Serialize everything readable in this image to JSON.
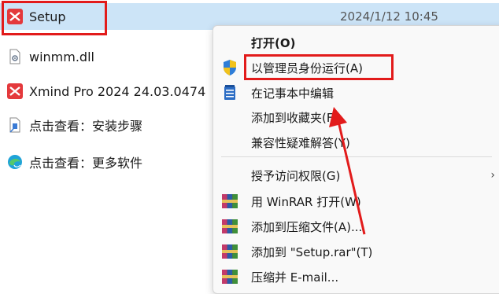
{
  "files": [
    {
      "name": "Setup",
      "date": "2024/1/12 10:45",
      "icon": "xmind-icon",
      "selected": true
    },
    {
      "name": "winmm.dll",
      "icon": "dll-file-icon"
    },
    {
      "name": "Xmind Pro 2024 24.03.0474",
      "icon": "xmind-icon"
    },
    {
      "name": "点击查看：安装步骤",
      "icon": "shortcut-document-icon"
    },
    {
      "name": "点击查看：更多软件",
      "icon": "edge-browser-icon"
    }
  ],
  "context_menu": {
    "items": [
      {
        "label": "打开(O)",
        "icon": "",
        "bold": true
      },
      {
        "label": "以管理员身份运行(A)",
        "icon": "uac-shield-icon"
      },
      {
        "label": "在记事本中编辑",
        "icon": "notepad-icon"
      },
      {
        "label": "添加到收藏夹(F)",
        "icon": ""
      },
      {
        "label": "兼容性疑难解答(Y)",
        "icon": ""
      },
      {
        "label": "授予访问权限(G)",
        "icon": "",
        "submenu": true
      },
      {
        "label": "用 WinRAR 打开(W)",
        "icon": "winrar-icon"
      },
      {
        "label": "添加到压缩文件(A)...",
        "icon": "winrar-icon"
      },
      {
        "label": "添加到 \"Setup.rar\"(T)",
        "icon": "winrar-icon"
      },
      {
        "label": "压缩并 E-mail...",
        "icon": "winrar-icon"
      }
    ],
    "submenu_chevron": "›"
  },
  "colors": {
    "selection": "#cce4f7",
    "highlight_red": "#e21b1b"
  }
}
